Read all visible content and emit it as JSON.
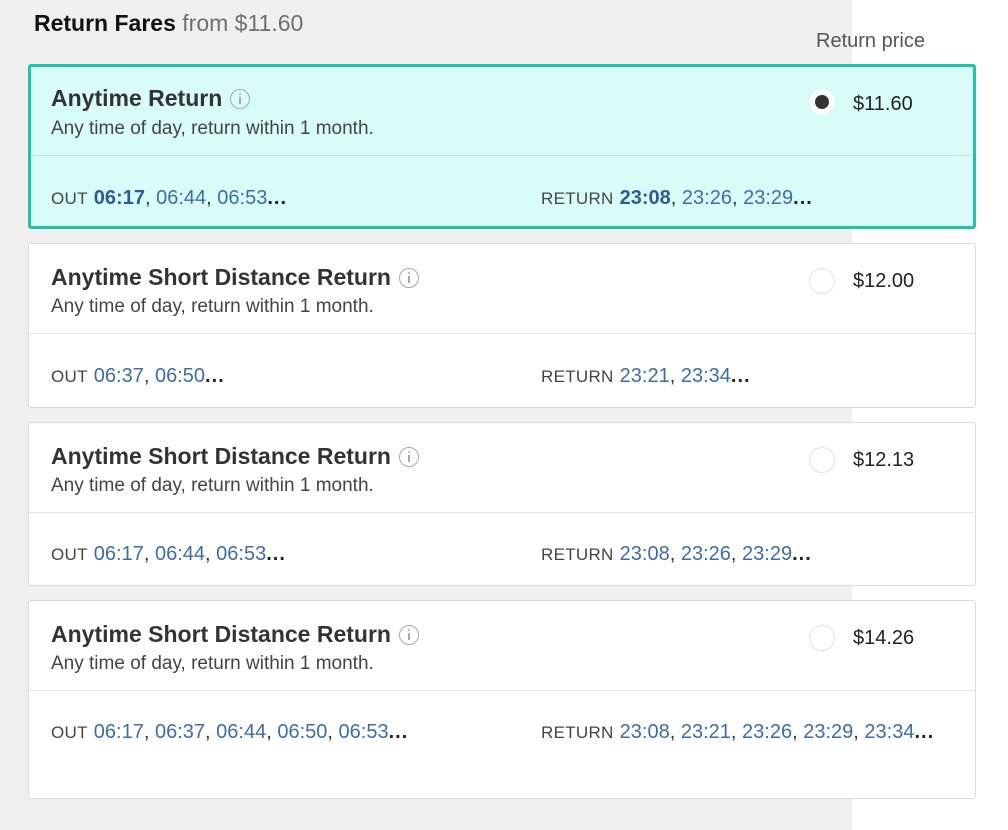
{
  "header": {
    "title": "Return Fares",
    "from_text": "from $11.60"
  },
  "column_label": "Return price",
  "out_label": "OUT",
  "return_label": "RETURN",
  "ellipsis": "...",
  "fares": [
    {
      "name": "Anytime Return",
      "description": "Any time of day, return within 1 month.",
      "price": "$11.60",
      "selected": true,
      "out_times": [
        "06:17",
        "06:44",
        "06:53"
      ],
      "return_times": [
        "23:08",
        "23:26",
        "23:29"
      ]
    },
    {
      "name": "Anytime Short Distance Return",
      "description": "Any time of day, return within 1 month.",
      "price": "$12.00",
      "selected": false,
      "out_times": [
        "06:37",
        "06:50"
      ],
      "return_times": [
        "23:21",
        "23:34"
      ]
    },
    {
      "name": "Anytime Short Distance Return",
      "description": "Any time of day, return within 1 month.",
      "price": "$12.13",
      "selected": false,
      "out_times": [
        "06:17",
        "06:44",
        "06:53"
      ],
      "return_times": [
        "23:08",
        "23:26",
        "23:29"
      ]
    },
    {
      "name": "Anytime Short Distance Return",
      "description": "Any time of day, return within 1 month.",
      "price": "$14.26",
      "selected": false,
      "out_times": [
        "06:17",
        "06:37",
        "06:44",
        "06:50",
        "06:53"
      ],
      "return_times": [
        "23:08",
        "23:21",
        "23:26",
        "23:29",
        "23:34"
      ]
    }
  ]
}
